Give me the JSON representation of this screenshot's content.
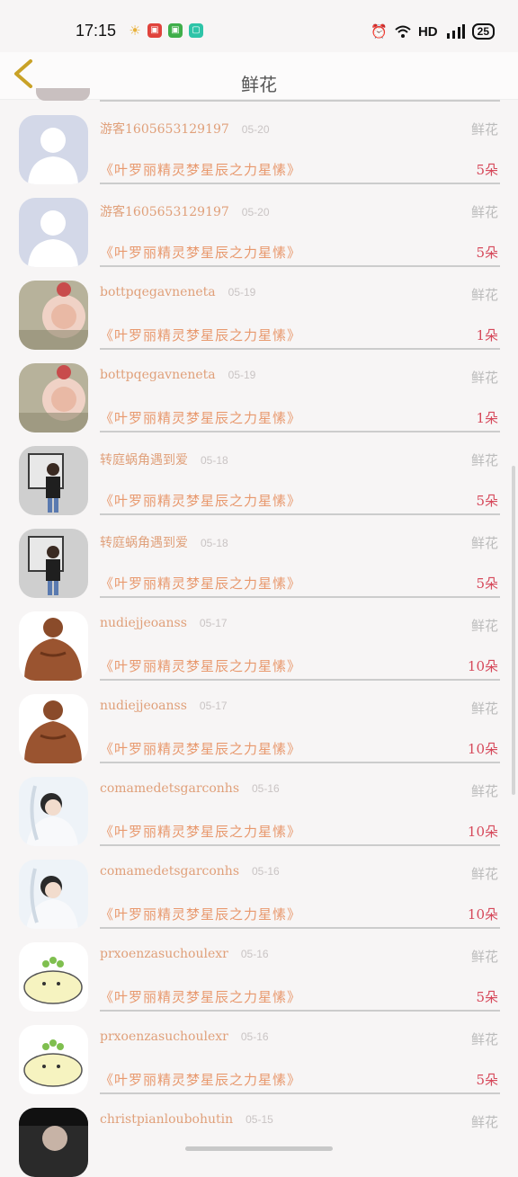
{
  "status_bar": {
    "time": "17:15",
    "network": "HD",
    "battery": "25"
  },
  "nav": {
    "title": "鲜花"
  },
  "items": [
    {
      "name": "游客1605653129197",
      "date": "05-20",
      "type": "鲜花",
      "gift": "《叶罗丽精灵梦星辰之力星愫》",
      "qty": "5朵",
      "avatar": "default"
    },
    {
      "name": "游客1605653129197",
      "date": "05-20",
      "type": "鲜花",
      "gift": "《叶罗丽精灵梦星辰之力星愫》",
      "qty": "5朵",
      "avatar": "default"
    },
    {
      "name": "bottpqegavneneta",
      "date": "05-19",
      "type": "鲜花",
      "gift": "《叶罗丽精灵梦星辰之力星愫》",
      "qty": "1朵",
      "avatar": "rose"
    },
    {
      "name": "bottpqegavneneta",
      "date": "05-19",
      "type": "鲜花",
      "gift": "《叶罗丽精灵梦星辰之力星愫》",
      "qty": "1朵",
      "avatar": "rose"
    },
    {
      "name": "转庭蜗角遇到爱",
      "date": "05-18",
      "type": "鲜花",
      "gift": "《叶罗丽精灵梦星辰之力星愫》",
      "qty": "5朵",
      "avatar": "man"
    },
    {
      "name": "转庭蜗角遇到爱",
      "date": "05-18",
      "type": "鲜花",
      "gift": "《叶罗丽精灵梦星辰之力星愫》",
      "qty": "5朵",
      "avatar": "man"
    },
    {
      "name": "nudiejjeoanss",
      "date": "05-17",
      "type": "鲜花",
      "gift": "《叶罗丽精灵梦星辰之力星愫》",
      "qty": "10朵",
      "avatar": "muscle"
    },
    {
      "name": "nudiejjeoanss",
      "date": "05-17",
      "type": "鲜花",
      "gift": "《叶罗丽精灵梦星辰之力星愫》",
      "qty": "10朵",
      "avatar": "muscle"
    },
    {
      "name": "comamedetsgarconhs",
      "date": "05-16",
      "type": "鲜花",
      "gift": "《叶罗丽精灵梦星辰之力星愫》",
      "qty": "10朵",
      "avatar": "white"
    },
    {
      "name": "comamedetsgarconhs",
      "date": "05-16",
      "type": "鲜花",
      "gift": "《叶罗丽精灵梦星辰之力星愫》",
      "qty": "10朵",
      "avatar": "white"
    },
    {
      "name": "prxoenzasuchoulexr",
      "date": "05-16",
      "type": "鲜花",
      "gift": "《叶罗丽精灵梦星辰之力星愫》",
      "qty": "5朵",
      "avatar": "cartoon"
    },
    {
      "name": "prxoenzasuchoulexr",
      "date": "05-16",
      "type": "鲜花",
      "gift": "《叶罗丽精灵梦星辰之力星愫》",
      "qty": "5朵",
      "avatar": "cartoon"
    },
    {
      "name": "christpianloubohutin",
      "date": "05-15",
      "type": "鲜花",
      "gift": "",
      "qty": "",
      "avatar": "dark"
    }
  ],
  "colors": {
    "name": "#e0a07a",
    "gift": "#e8996e",
    "qty": "#d6485a",
    "back_arrow": "#c9a227"
  }
}
